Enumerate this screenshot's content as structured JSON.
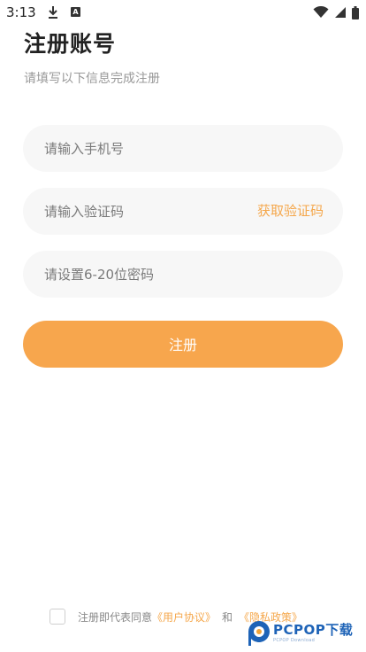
{
  "status_bar": {
    "time": "3:13",
    "download_icon": "download-icon",
    "notification_letter": "A",
    "wifi_icon": "wifi-icon",
    "signal_icon": "signal-icon",
    "battery_icon": "battery-icon"
  },
  "page": {
    "title": "注册账号",
    "subtitle": "请填写以下信息完成注册"
  },
  "form": {
    "phone_placeholder": "请输入手机号",
    "code_placeholder": "请输入验证码",
    "get_code_label": "获取验证码",
    "password_placeholder": "请设置6-20位密码",
    "submit_label": "注册"
  },
  "agreement": {
    "checked": false,
    "prefix": "注册即代表同意",
    "user_agreement": "《用户协议》",
    "and": "和",
    "privacy_policy": "《隐私政策》"
  },
  "watermark": {
    "main": "PCPOP下载",
    "sub": "PCPOP Download"
  },
  "colors": {
    "accent": "#f7a64d",
    "link": "#f5a74b",
    "field_bg": "#f7f7f7",
    "title": "#222222",
    "muted": "#999999"
  }
}
